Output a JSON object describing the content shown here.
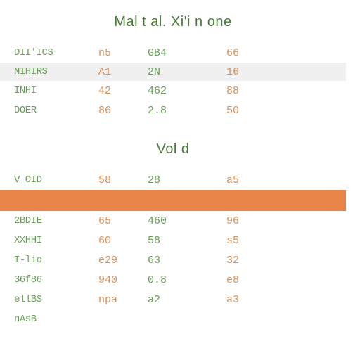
{
  "block_a": {
    "title": "Mal t al.  Xi'i n one",
    "rows": [
      {
        "label": "DII'ICS",
        "v1": "n5",
        "v2": "GB4",
        "v3": "66",
        "band": false
      },
      {
        "label": "NIHIRS",
        "v1": "A1",
        "v2": "2N",
        "v3": "16",
        "band": true
      },
      {
        "label": "INHI",
        "v1": "42",
        "v2": "462",
        "v3": "88",
        "band": false
      },
      {
        "label": "DOER",
        "v1": "86",
        "v2": "2.8",
        "v3": "50",
        "band": false
      }
    ]
  },
  "block_b": {
    "title": "Vol d",
    "rows": [
      {
        "label": "V OID",
        "v1": "58",
        "v2": "28",
        "v3": "a5",
        "band": false,
        "highlight": false
      },
      {
        "label": "",
        "v1": "",
        "v2": "",
        "v3": "",
        "band": false,
        "highlight": true
      },
      {
        "label": "2BDIE",
        "v1": "65",
        "v2": "460",
        "v3": "96",
        "band": false,
        "highlight": false
      },
      {
        "label": "XXHHI",
        "v1": "60",
        "v2": "58",
        "v3": "s5",
        "band": false,
        "highlight": false
      },
      {
        "label": "I-lio",
        "v1": "e29",
        "v2": "63",
        "v3": "32",
        "band": false,
        "highlight": false
      },
      {
        "label": "36f86",
        "v1": "940",
        "v2": "0.8",
        "v3": "e8",
        "band": false,
        "highlight": false
      },
      {
        "label": "ellBS",
        "v1": "npa",
        "v2": "a2",
        "v3": "a3",
        "band": false,
        "highlight": false
      },
      {
        "label": "nAsB",
        "v1": "",
        "v2": "",
        "v3": "",
        "band": false,
        "highlight": false
      }
    ]
  },
  "chart_data": [
    {
      "type": "table",
      "title": "Mal t al.  Xi'i n one",
      "columns": [
        "label",
        "v1",
        "v2",
        "v3"
      ],
      "rows": [
        [
          "DII'ICS",
          "n5",
          "GB4",
          "66"
        ],
        [
          "NIHIRS",
          "A1",
          "2N",
          "16"
        ],
        [
          "INHI",
          "42",
          "462",
          "88"
        ],
        [
          "DOER",
          "86",
          "2.8",
          "50"
        ]
      ]
    },
    {
      "type": "table",
      "title": "Vol d",
      "columns": [
        "label",
        "v1",
        "v2",
        "v3"
      ],
      "rows": [
        [
          "V OID",
          "58",
          "28",
          "a5"
        ],
        [
          "",
          "",
          "",
          ""
        ],
        [
          "2BDIE",
          "65",
          "460",
          "96"
        ],
        [
          "XXHHI",
          "60",
          "58",
          "s5"
        ],
        [
          "I-lio",
          "e29",
          "63",
          "32"
        ],
        [
          "36f86",
          "940",
          "0.8",
          "e8"
        ],
        [
          "ellBS",
          "npa",
          "a2",
          "a3"
        ],
        [
          "nAsB",
          "",
          "",
          ""
        ]
      ],
      "highlight_row_index": 1
    }
  ]
}
